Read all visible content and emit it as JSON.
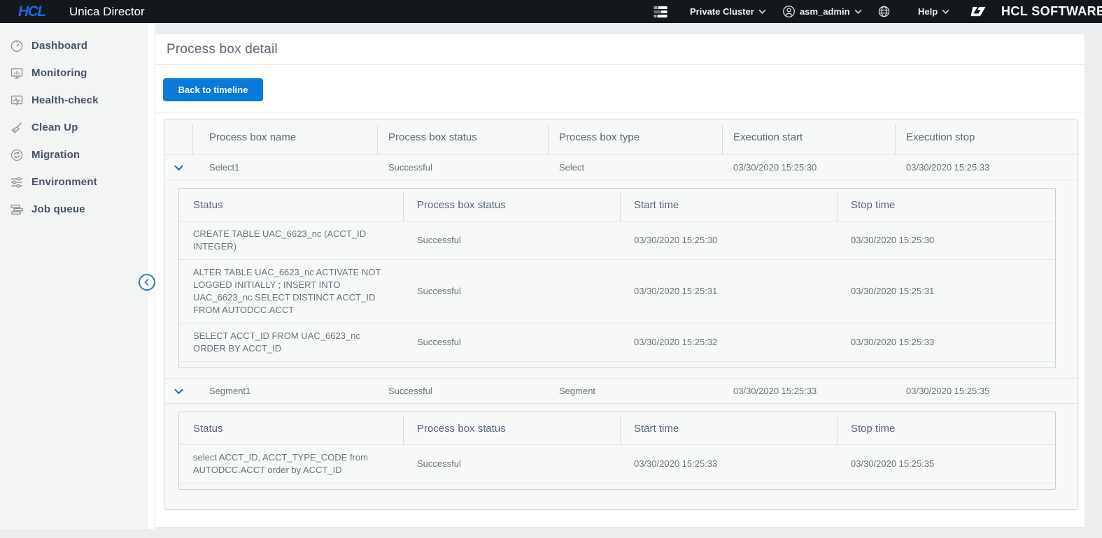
{
  "colors": {
    "header_bg": "#14181d",
    "brand_blue": "#2069dd",
    "accent_blue": "#0b79d8",
    "page_bg": "#ecedef",
    "sidebar_bg": "#f3f4f4",
    "table_bg": "#f7f8f8",
    "table_border": "#d2d6db",
    "header_text": "#57677c",
    "cell_text": "#6a737d",
    "sidebar_text": "#44536a",
    "title_text": "#5d6775"
  },
  "header": {
    "brand": "HCL",
    "app_title": "Unica Director",
    "cluster_label": "Private Cluster",
    "username": "asm_admin",
    "help_label": "Help",
    "company_name": "HCL SOFTWARE"
  },
  "sidebar": {
    "items": [
      {
        "label": "Dashboard"
      },
      {
        "label": "Monitoring"
      },
      {
        "label": "Health-check"
      },
      {
        "label": "Clean Up"
      },
      {
        "label": "Migration"
      },
      {
        "label": "Environment"
      },
      {
        "label": "Job queue"
      }
    ]
  },
  "main": {
    "page_title": "Process box detail",
    "back_button_label": "Back to timeline",
    "process_table": {
      "columns": {
        "name": "Process box name",
        "status": "Process box status",
        "type": "Process box type",
        "start": "Execution start",
        "stop": "Execution stop"
      },
      "detail_columns": {
        "status": "Status",
        "box_status": "Process box status",
        "start": "Start time",
        "stop": "Stop time"
      },
      "rows": [
        {
          "name": "Select1",
          "status": "Successful",
          "type": "Select",
          "start": "03/30/2020 15:25:30",
          "stop": "03/30/2020 15:25:33",
          "details": [
            {
              "status": "CREATE TABLE UAC_6623_nc (ACCT_ID INTEGER)",
              "box_status": "Successful",
              "start": "03/30/2020 15:25:30",
              "stop": "03/30/2020 15:25:30"
            },
            {
              "status": "ALTER TABLE UAC_6623_nc ACTIVATE NOT LOGGED INITIALLY ; INSERT INTO UAC_6623_nc SELECT DISTINCT ACCT_ID FROM AUTODCC.ACCT",
              "box_status": "Successful",
              "start": "03/30/2020 15:25:31",
              "stop": "03/30/2020 15:25:31"
            },
            {
              "status": "SELECT ACCT_ID FROM UAC_6623_nc ORDER BY ACCT_ID",
              "box_status": "Successful",
              "start": "03/30/2020 15:25:32",
              "stop": "03/30/2020 15:25:33"
            }
          ]
        },
        {
          "name": "Segment1",
          "status": "Successful",
          "type": "Segment",
          "start": "03/30/2020 15:25:33",
          "stop": "03/30/2020 15:25:35",
          "details": [
            {
              "status": "select ACCT_ID, ACCT_TYPE_CODE from AUTODCC.ACCT order by ACCT_ID",
              "box_status": "Successful",
              "start": "03/30/2020 15:25:33",
              "stop": "03/30/2020 15:25:35"
            }
          ]
        }
      ]
    }
  }
}
